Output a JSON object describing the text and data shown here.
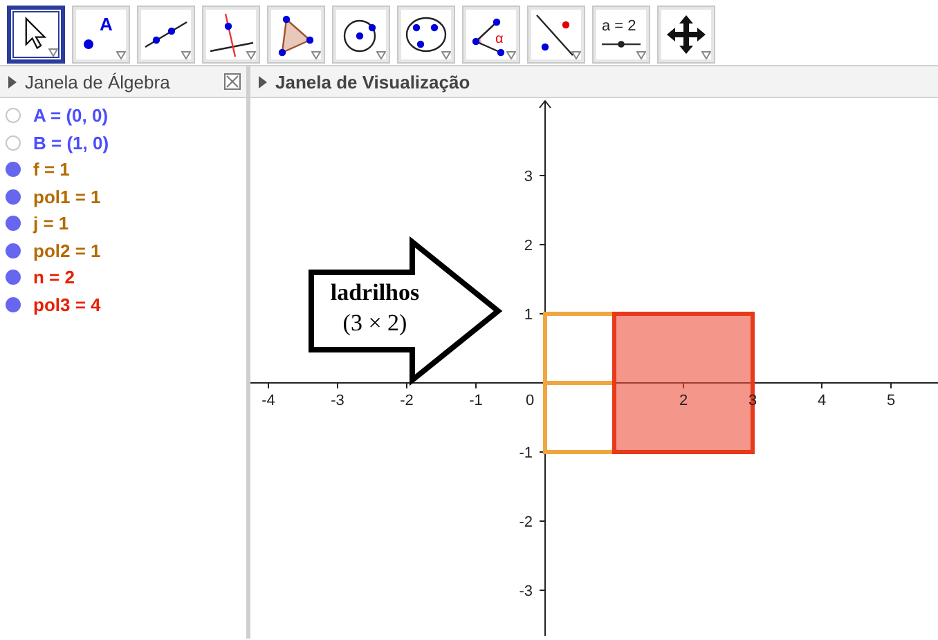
{
  "toolbar": {
    "tools": [
      {
        "kind": "move",
        "selected": true
      },
      {
        "kind": "point",
        "selected": false,
        "label": "A"
      },
      {
        "kind": "line",
        "selected": false
      },
      {
        "kind": "perpendicular",
        "selected": false
      },
      {
        "kind": "polygon",
        "selected": false
      },
      {
        "kind": "circle",
        "selected": false
      },
      {
        "kind": "circle3",
        "selected": false
      },
      {
        "kind": "angle",
        "selected": false,
        "label": "α"
      },
      {
        "kind": "reflect",
        "selected": false
      },
      {
        "kind": "slider",
        "selected": false,
        "label": "a = 2"
      },
      {
        "kind": "pan",
        "selected": false
      }
    ]
  },
  "algebra_view": {
    "title": "Janela de Álgebra",
    "items": [
      {
        "text": "A = (0, 0)",
        "visible": false,
        "color": "#4d4dff"
      },
      {
        "text": "B = (1, 0)",
        "visible": false,
        "color": "#4d4dff"
      },
      {
        "text": "f = 1",
        "visible": true,
        "color": "#b36b00"
      },
      {
        "text": "pol1 = 1",
        "visible": true,
        "color": "#b36b00"
      },
      {
        "text": "j = 1",
        "visible": true,
        "color": "#b36b00"
      },
      {
        "text": "pol2 = 1",
        "visible": true,
        "color": "#b36b00"
      },
      {
        "text": "n = 2",
        "visible": true,
        "color": "#e62000"
      },
      {
        "text": "pol3 = 4",
        "visible": true,
        "color": "#e62000"
      }
    ]
  },
  "graphics_view": {
    "title": "Janela de Visualização",
    "x_tick_labels": [
      "-4",
      "-3",
      "-2",
      "-1",
      "0",
      "2",
      "3",
      "4",
      "5"
    ],
    "y_tick_labels": [
      "3",
      "2",
      "1",
      "-1",
      "-2",
      "-3"
    ],
    "arrow_text": [
      "ladrilhos",
      "(3 × 2)"
    ]
  }
}
